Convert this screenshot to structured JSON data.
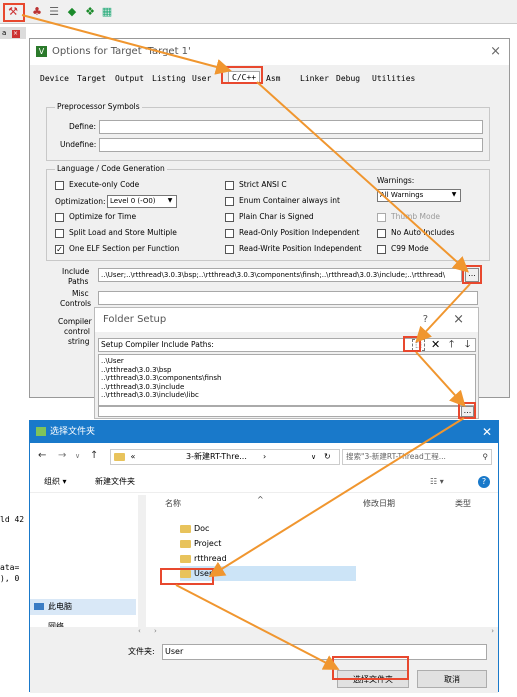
{
  "toolbar": {
    "icons": [
      "options-for-target-icon",
      "load-icon",
      "manage-icon",
      "green-diamond-icon",
      "green-arrows-icon",
      "build-all-icon"
    ]
  },
  "options_dialog": {
    "title": "Options for Target 'Target 1'",
    "tabs": [
      "Device",
      "Target",
      "Output",
      "Listing",
      "User",
      "C/C++",
      "Asm",
      "Linker",
      "Debug",
      "Utilities"
    ],
    "active_tab": "C/C++",
    "preprocessor": {
      "title": "Preprocessor Symbols",
      "define_label": "Define:",
      "define_value": "",
      "undefine_label": "Undefine:",
      "undefine_value": ""
    },
    "language": {
      "title": "Language / Code Generation",
      "left_checks": [
        {
          "label": "Execute-only Code",
          "checked": false
        },
        {
          "label": "Optimize for Time",
          "checked": false
        },
        {
          "label": "Split Load and Store Multiple",
          "checked": false
        },
        {
          "label": "One ELF Section per Function",
          "checked": true
        }
      ],
      "optimization_label": "Optimization:",
      "optimization_value": "Level 0 (-O0)",
      "mid_checks": [
        {
          "label": "Strict ANSI C",
          "checked": false
        },
        {
          "label": "Enum Container always int",
          "checked": false
        },
        {
          "label": "Plain Char is Signed",
          "checked": false
        },
        {
          "label": "Read-Only Position Independent",
          "checked": false
        },
        {
          "label": "Read-Write Position Independent",
          "checked": false
        }
      ],
      "warnings_label": "Warnings:",
      "warnings_value": "All Warnings",
      "right_checks": [
        {
          "label": "Thumb Mode",
          "checked": false,
          "disabled": true
        },
        {
          "label": "No Auto Includes",
          "checked": false,
          "disabled": false
        },
        {
          "label": "C99 Mode",
          "checked": false,
          "disabled": false
        }
      ]
    },
    "include_label_1": "Include",
    "include_label_2": "Paths",
    "include_value": "..\\User;..\\rtthread\\3.0.3\\bsp;..\\rtthread\\3.0.3\\components\\finsh;..\\rtthread\\3.0.3\\include;..\\rtthread\\",
    "misc_label_1": "Misc",
    "misc_label_2": "Controls",
    "compiler_label_1": "Compiler",
    "compiler_label_2": "control",
    "compiler_label_3": "string",
    "browse": "..."
  },
  "folder_setup": {
    "title": "Folder Setup",
    "help": "?",
    "close": "×",
    "subtitle": "Setup Compiler Include Paths:",
    "paths": [
      "..\\User",
      "..\\rtthread\\3.0.3\\bsp",
      "..\\rtthread\\3.0.3\\components\\finsh",
      "..\\rtthread\\3.0.3\\include",
      "..\\rtthread\\3.0.3\\include\\libc"
    ],
    "browse": "..."
  },
  "folder_browser": {
    "title": "选择文件夹",
    "breadcrumb_overflow": "«",
    "breadcrumb_path": "3-新建RT-Thre...",
    "search_placeholder": "搜索\"3-新建RT-Thread工程...",
    "organize": "组织 ▾",
    "new_folder": "新建文件夹",
    "col_name": "名称",
    "col_modified": "修改日期",
    "col_type": "类型",
    "folders": [
      "Doc",
      "Project",
      "rtthread",
      "User"
    ],
    "selected_folder": "User",
    "nav_pc": "此电脑",
    "nav_network": "网络",
    "folder_label": "文件夹:",
    "folder_value": "User",
    "select_button": "选择文件夹",
    "cancel_button": "取消"
  },
  "background_code": {
    "line1": "ld 42",
    "line2": "ata=",
    "line3": "), 0"
  },
  "small_tab": "a"
}
